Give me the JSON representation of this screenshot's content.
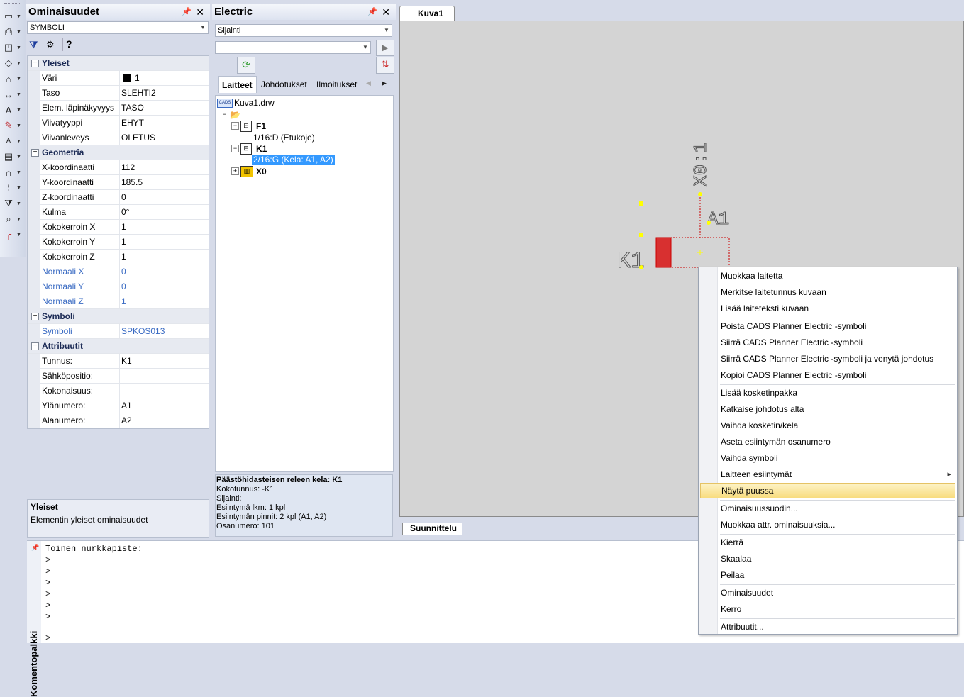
{
  "left_toolbar": {
    "tools": [
      {
        "icon": "rectangle-icon"
      },
      {
        "icon": "print-icon"
      },
      {
        "icon": "window-icon"
      },
      {
        "icon": "shapes-icon"
      },
      {
        "icon": "house-icon"
      },
      {
        "icon": "dimension-icon"
      },
      {
        "icon": "text-icon"
      },
      {
        "icon": "pencil-icon"
      },
      {
        "icon": "text-style-icon"
      },
      {
        "icon": "hatch-icon"
      },
      {
        "icon": "magnet-icon"
      },
      {
        "icon": "grid-dots-icon"
      },
      {
        "icon": "filter-icon"
      },
      {
        "icon": "zoom-icon"
      },
      {
        "icon": "arc-icon"
      }
    ]
  },
  "properties": {
    "title": "Ominaisuudet",
    "selector": "SYMBOLI",
    "categories": {
      "yleiset": "Yleiset",
      "geometria": "Geometria",
      "symboli": "Symboli",
      "attribuutit": "Attribuutit"
    },
    "yleiset": [
      {
        "name": "Väri",
        "value": "1"
      },
      {
        "name": "Taso",
        "value": "SLEHTI2"
      },
      {
        "name": "Elem. läpinäkyvyys",
        "value": "TASO"
      },
      {
        "name": "Viivatyyppi",
        "value": "EHYT"
      },
      {
        "name": "Viivanleveys",
        "value": "OLETUS"
      }
    ],
    "geometria": [
      {
        "name": "X-koordinaatti",
        "value": "112"
      },
      {
        "name": "Y-koordinaatti",
        "value": "185.5"
      },
      {
        "name": "Z-koordinaatti",
        "value": "0"
      },
      {
        "name": "Kulma",
        "value": "0°"
      },
      {
        "name": "Kokokerroin X",
        "value": "1"
      },
      {
        "name": "Kokokerroin Y",
        "value": "1"
      },
      {
        "name": "Kokokerroin Z",
        "value": "1"
      },
      {
        "name": "Normaali X",
        "value": "0"
      },
      {
        "name": "Normaali Y",
        "value": "0"
      },
      {
        "name": "Normaali Z",
        "value": "1"
      }
    ],
    "symboli": [
      {
        "name": "Symboli",
        "value": "SPKOS013"
      }
    ],
    "attribuutit": [
      {
        "name": "Tunnus:",
        "value": "K1"
      },
      {
        "name": "Sähköpositio:",
        "value": ""
      },
      {
        "name": "Kokonaisuus:",
        "value": ""
      },
      {
        "name": "Ylänumero:",
        "value": "A1"
      },
      {
        "name": "Alanumero:",
        "value": "A2"
      }
    ],
    "description_title": "Yleiset",
    "description_text": "Elementin yleiset ominaisuudet"
  },
  "electric": {
    "title": "Electric",
    "location_combo": "Sijainti",
    "search_combo": "",
    "tabs": [
      "Laitteet",
      "Johdotukset",
      "Ilmoitukset"
    ],
    "tree": {
      "root": "Kuva1.drw",
      "f1": "F1",
      "f1_child": "1/16:D (Etukoje)",
      "k1": "K1",
      "k1_child": "2/16:G (Kela: A1, A2)",
      "x0": "X0"
    },
    "info": {
      "title": "Päästöhidasteisen releen kela: K1",
      "lines": [
        "Kokotunnus: -K1",
        "Sijainti:",
        "Esiintymä lkm: 1 kpl",
        "Esiintymän pinnit: 2 kpl (A1, A2)",
        "Osanumero: 101"
      ]
    }
  },
  "drawing": {
    "tab": "Kuva1",
    "bottom_tab": "Suunnittelu",
    "labels": {
      "x01": "X0:1",
      "a1": "A1",
      "k1": "K1"
    },
    "colors": {
      "symbol": "#cc0000",
      "grip": "#ffff00",
      "background": "#d4d4d4"
    }
  },
  "command": {
    "title": "Komentopalkki",
    "lines": [
      "Toinen nurkkapiste:",
      ">",
      ">",
      ">",
      ">",
      ">",
      ">"
    ],
    "prompt": ">"
  },
  "context_menu": {
    "groups": [
      [
        "Muokkaa laitetta",
        "Merkitse laitetunnus kuvaan",
        "Lisää laiteteksti kuvaan"
      ],
      [
        "Poista CADS Planner Electric -symboli",
        "Siirrä CADS Planner Electric -symboli",
        "Siirrä CADS Planner Electric -symboli ja venytä johdotus",
        "Kopioi CADS Planner Electric -symboli"
      ],
      [
        "Lisää kosketinpakka",
        "Katkaise johdotus alta",
        "Vaihda kosketin/kela",
        "Aseta esiintymän osanumero",
        "Vaihda symboli",
        "Laitteen esiintymät",
        "Näytä puussa"
      ],
      [
        "Ominaisuussuodin...",
        "Muokkaa attr. ominaisuuksia..."
      ],
      [
        "Kierrä",
        "Skaalaa",
        "Peilaa"
      ],
      [
        "Ominaisuudet",
        "Kerro"
      ],
      [
        "Attribuutit..."
      ]
    ],
    "highlighted": "Näytä puussa",
    "submenu_item": "Laitteen esiintymät"
  }
}
